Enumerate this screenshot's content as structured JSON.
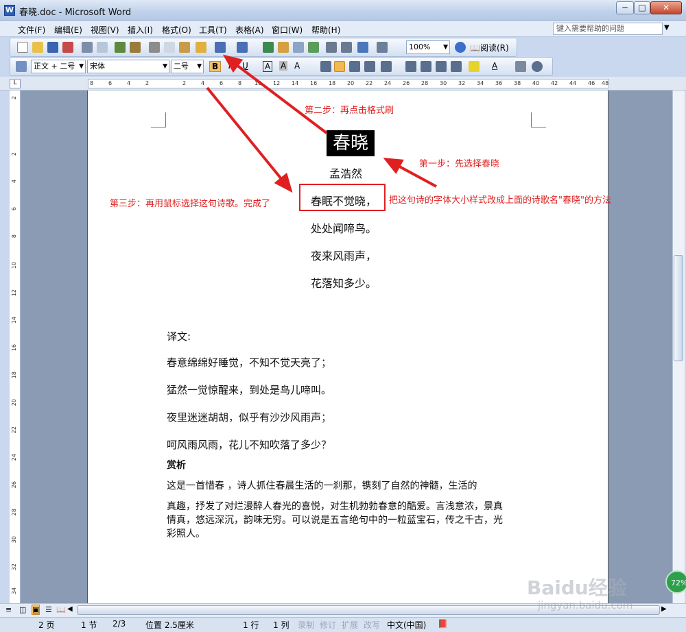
{
  "window": {
    "title": "春晓.doc - Microsoft Word",
    "app_icon": "W"
  },
  "menu": {
    "items": [
      "文件(F)",
      "编辑(E)",
      "视图(V)",
      "插入(I)",
      "格式(O)",
      "工具(T)",
      "表格(A)",
      "窗口(W)",
      "帮助(H)"
    ],
    "help_placeholder": "键入需要帮助的问题"
  },
  "toolbar": {
    "zoom": "100%",
    "read_label": "阅读(R)",
    "style_value": "正文 + 二号",
    "font_value": "宋体",
    "size_value": "二号",
    "bold": "B",
    "italic": "I",
    "underline": "U",
    "border_a": "A",
    "shade_a": "A",
    "font_color_a": "A",
    "char_scale": "A"
  },
  "ruler": {
    "ticks": [
      "8",
      "6",
      "4",
      "2",
      "2",
      "4",
      "6",
      "8",
      "10",
      "12",
      "14",
      "16",
      "18",
      "20",
      "22",
      "24",
      "26",
      "28",
      "30",
      "32",
      "34",
      "36",
      "38",
      "40",
      "42",
      "44",
      "46",
      "48"
    ]
  },
  "vruler": {
    "ticks": [
      "2",
      "2",
      "4",
      "6",
      "8",
      "10",
      "12",
      "14",
      "16",
      "18",
      "20",
      "22",
      "24",
      "26",
      "28",
      "30",
      "32",
      "34"
    ]
  },
  "document": {
    "title": "春晓",
    "author": "孟浩然",
    "lines": [
      "春眠不觉晓，",
      "处处闻啼鸟。",
      "夜来风雨声，",
      "花落知多少。"
    ],
    "translation_heading": "译文:",
    "translation": [
      "春意绵绵好睡觉，不知不觉天亮了；",
      "猛然一觉惊醒来，到处是鸟儿啼叫。",
      "夜里迷迷胡胡，似乎有沙沙风雨声；",
      "呵风雨风雨，花儿不知吹落了多少？"
    ],
    "appreciation_heading": "赏析",
    "appreciation": [
      "这是一首惜春  ，诗人抓住春晨生活的一刹那，镌刻了自然的神髓，生活的",
      "真趣，抒发了对烂漫醉人春光的喜悦，对生机勃勃春意的酷爱。言浅意浓，景真",
      "情真，悠远深沉，韵味无穷。可以说是五言绝句中的一粒蓝宝石，传之千古，光",
      "彩照人。"
    ]
  },
  "annotations": {
    "step1": "第一步：先选择春晓",
    "step2": "第二步：再点击格式刷",
    "step3": "第三步：再用鼠标选择这句诗歌。完成了",
    "note": "把这句诗的字体大小样式改成上面的诗歌名\"春晓\"的方法"
  },
  "status": {
    "page": "2 页",
    "section": "1 节",
    "pages": "2/3",
    "position": "位置 2.5厘米",
    "line": "1 行",
    "column": "1 列",
    "rec": "录制",
    "track": "修订",
    "ext": "扩展",
    "ovr": "改写",
    "language": "中文(中国)"
  },
  "watermark": {
    "brand": "Baidu经验",
    "url": "jingyan.baidu.com",
    "badge": "72%"
  },
  "colors": {
    "annotation": "#e02020",
    "page_bg": "#ffffff",
    "doc_area": "#8a9bb3",
    "title_bg": "#000000"
  }
}
